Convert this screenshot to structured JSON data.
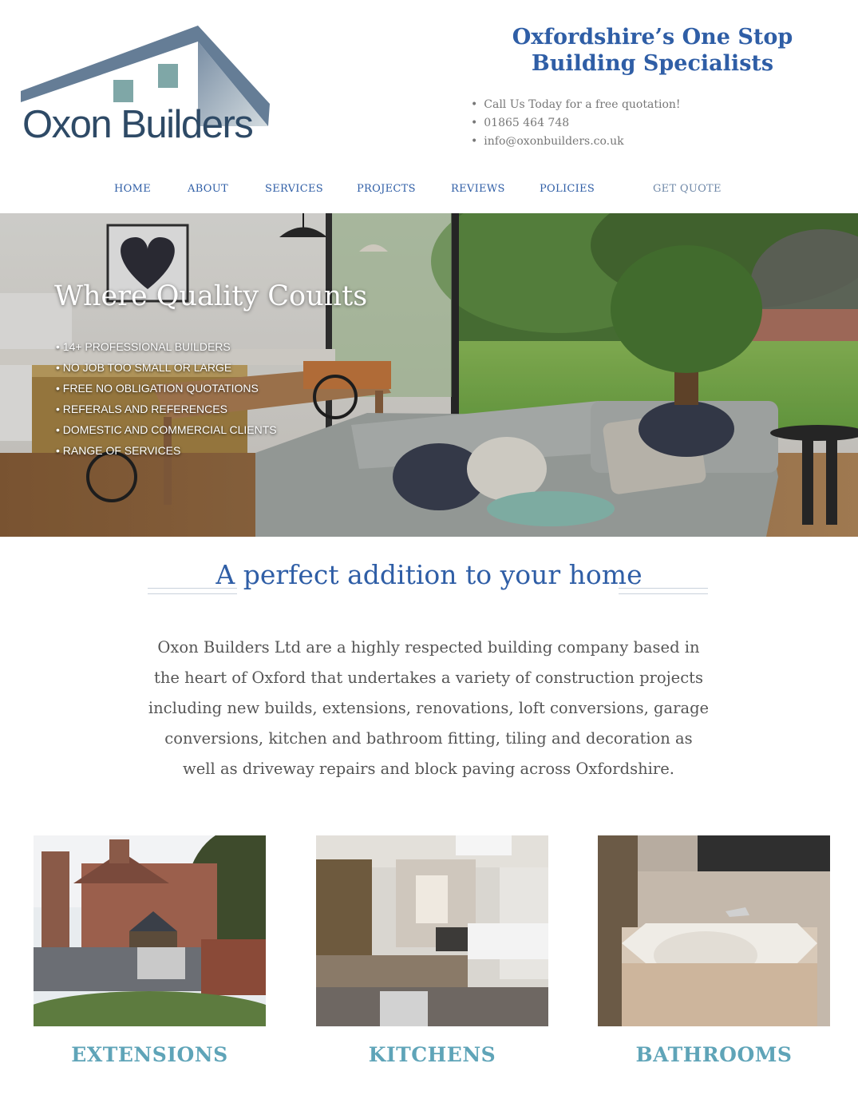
{
  "brand": {
    "logo_text": "Oxon Builders",
    "tagline": "Oxfordshire’s One Stop Building Specialists"
  },
  "contact": [
    "Call Us Today for a free quotation!",
    "01865 464 748",
    "info@oxonbuilders.co.uk"
  ],
  "nav": [
    {
      "label": "HOME"
    },
    {
      "label": "ABOUT"
    },
    {
      "label": "SERVICES"
    },
    {
      "label": "PROJECTS"
    },
    {
      "label": "REVIEWS"
    },
    {
      "label": "POLICIES"
    },
    {
      "label": "GET QUOTE"
    }
  ],
  "hero": {
    "title": "Where Quality Counts",
    "points": [
      "14+ PROFESSIONAL BUILDERS",
      "NO JOB TOO SMALL OR LARGE",
      "FREE NO OBLIGATION QUOTATIONS",
      "REFERALS AND REFERENCES",
      "DOMESTIC AND COMMERCIAL CLIENTS",
      "RANGE OF SERVICES"
    ]
  },
  "section": {
    "title": "A perfect addition to your home",
    "intro": "Oxon Builders Ltd are a highly respected building company based in the heart of Oxford that undertakes a variety of construction projects including new builds, extensions, renovations, loft conversions, garage conversions, kitchen and bathroom fitting, tiling and decoration as well as driveway repairs and block paving across Oxfordshire."
  },
  "services": [
    {
      "label": "EXTENSIONS"
    },
    {
      "label": "KITCHENS"
    },
    {
      "label": "BATHROOMS"
    }
  ],
  "colors": {
    "primary": "#2f5ea6",
    "accent": "#5fa4b8",
    "logo_dark": "#2e4a66",
    "logo_teal": "#7fa7a7"
  }
}
